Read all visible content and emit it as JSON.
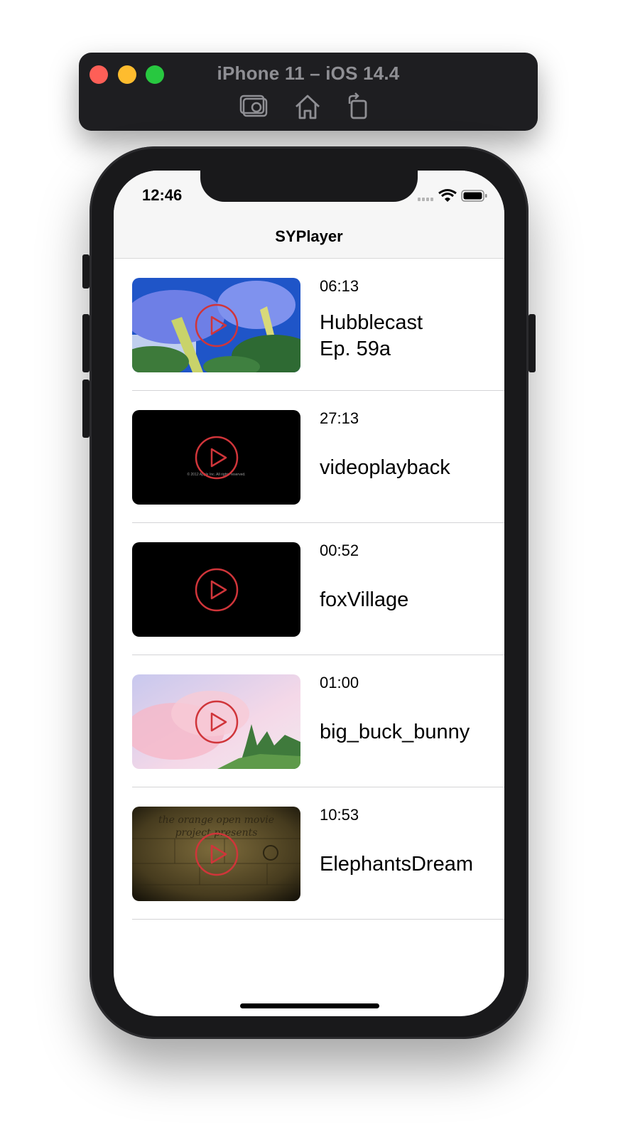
{
  "simulator": {
    "title": "iPhone 11 – iOS 14.4",
    "tools": [
      {
        "name": "screenshot",
        "icon": "camera-icon"
      },
      {
        "name": "home",
        "icon": "home-icon"
      },
      {
        "name": "rotate",
        "icon": "rotate-icon"
      }
    ]
  },
  "status_bar": {
    "time": "12:46"
  },
  "nav": {
    "title": "SYPlayer"
  },
  "videos": [
    {
      "duration": "06:13",
      "title": "Hubblecast\nEp. 59a",
      "thumbnail": "blue flowers"
    },
    {
      "duration": "27:13",
      "title": "videoplayback",
      "thumbnail": "black frame",
      "caption": "© 2012 Apple Inc. All rights reserved."
    },
    {
      "duration": "00:52",
      "title": "foxVillage",
      "thumbnail": "black frame"
    },
    {
      "duration": "01:00",
      "title": "big_buck_bunny",
      "thumbnail": "pink sky with trees"
    },
    {
      "duration": "10:53",
      "title": "ElephantsDream",
      "thumbnail": "dark stone wall",
      "caption": "the orange open movie project presents"
    }
  ],
  "colors": {
    "play_icon": "#d0353a",
    "close": "#fe5f57",
    "minimize": "#febc2e",
    "maximize": "#28c840"
  }
}
